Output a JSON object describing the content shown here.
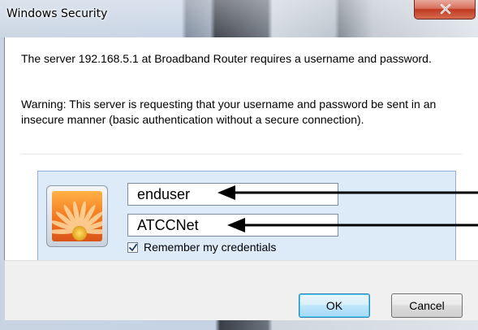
{
  "window": {
    "title": "Windows Security"
  },
  "message": {
    "line1": "The server 192.168.5.1 at Broadband Router requires a username and password.",
    "warning": "Warning: This server is requesting that your username and password be sent in an insecure manner (basic authentication without a secure connection)."
  },
  "credentials": {
    "username_value": "enduser",
    "password_value": "ATCCNet",
    "remember_label": "Remember my credentials",
    "remember_checked": true
  },
  "buttons": {
    "ok_label": "OK",
    "cancel_label": "Cancel"
  },
  "icons": {
    "close": "close-icon",
    "avatar": "user-flower-tile",
    "check": "check-icon"
  },
  "colors": {
    "cred_box_bg": "#ddeaf8",
    "close_button": "#c13a22",
    "ok_border": "#3c7fb1"
  }
}
